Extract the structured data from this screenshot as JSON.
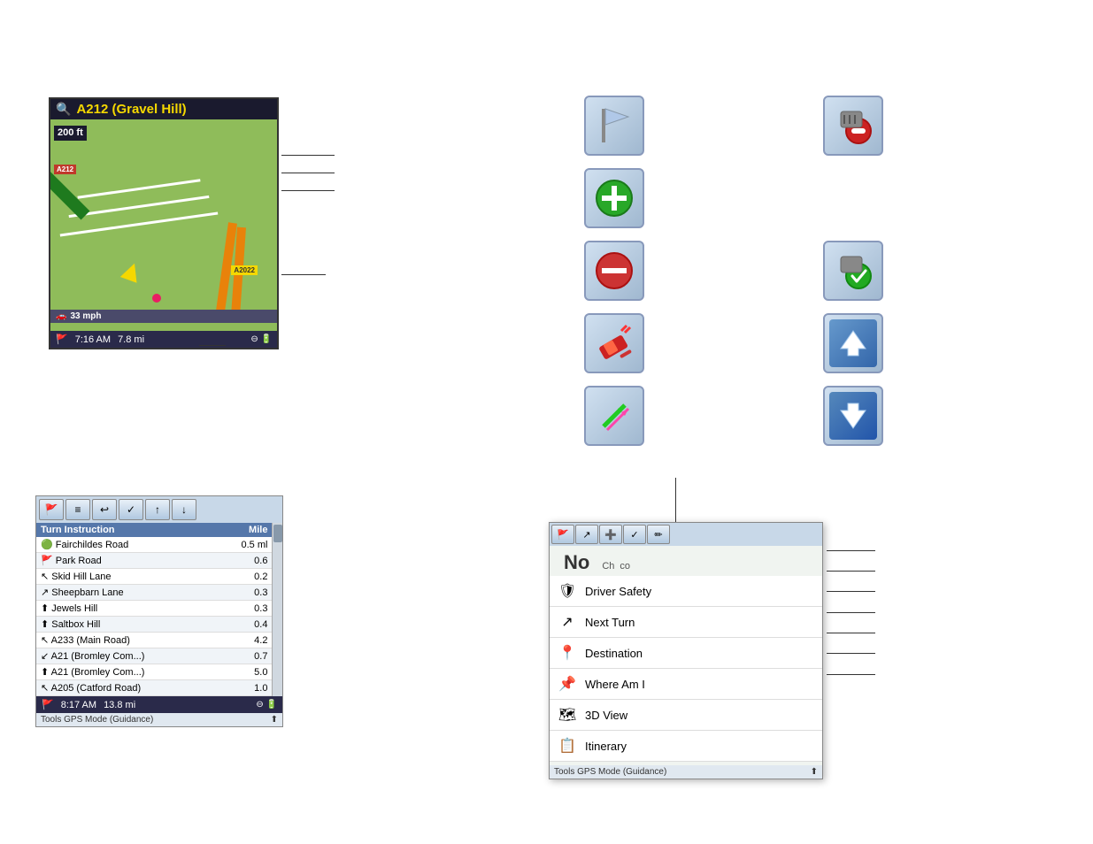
{
  "map": {
    "title": "A212 (Gravel Hill)",
    "distance_badge": "200\nft",
    "speed": "33 mph",
    "road_label": "A212",
    "road_label2": "A2022",
    "footer_time": "7:16 AM",
    "footer_dist": "7.8 mi"
  },
  "itinerary": {
    "toolbar_buttons": [
      "🚩",
      "≡",
      "↩",
      "✓",
      "↑",
      "↓"
    ],
    "columns": [
      "Turn Instruction",
      "Mile"
    ],
    "rows": [
      {
        "icon": "🟢",
        "name": "Fairchildes Road",
        "mile": "0.5 ml"
      },
      {
        "icon": "🚩",
        "name": "Park Road",
        "mile": "0.6"
      },
      {
        "icon": "↖",
        "name": "Skid Hill Lane",
        "mile": "0.2"
      },
      {
        "icon": "↗",
        "name": "Sheepbarn Lane",
        "mile": "0.3"
      },
      {
        "icon": "⬆",
        "name": "Jewels Hill",
        "mile": "0.3"
      },
      {
        "icon": "⬆",
        "name": "Saltbox Hill",
        "mile": "0.4"
      },
      {
        "icon": "↖",
        "name": "A233 (Main Road)",
        "mile": "4.2"
      },
      {
        "icon": "↙",
        "name": "A21 (Bromley Com...",
        "mile": "0.7"
      },
      {
        "icon": "⬆",
        "name": "A21 (Bromley Com...",
        "mile": "5.0"
      },
      {
        "icon": "↖",
        "name": "A205 (Catford Road)",
        "mile": "1.0"
      }
    ],
    "footer_time": "8:17 AM",
    "footer_dist": "13.8 mi",
    "footer_label": "Tools GPS Mode (Guidance)"
  },
  "icon_buttons": {
    "flag": {
      "label": "Flag",
      "symbol": "🏳"
    },
    "plus": {
      "label": "Add Waypoint",
      "symbol": "➕"
    },
    "minus": {
      "label": "Remove Waypoint",
      "symbol": "➖"
    },
    "eraser_red": {
      "label": "Delete Route",
      "symbol": "🗑"
    },
    "arrow_green": {
      "label": "Route Arrow Green",
      "symbol": "↗"
    },
    "check_green": {
      "label": "Accept",
      "symbol": "✅"
    },
    "arrow_up": {
      "label": "Move Up",
      "symbol": "⬆"
    },
    "arrow_down": {
      "label": "Move Down",
      "symbol": "⬇"
    }
  },
  "dropdown": {
    "toolbar_buttons": [
      "🚩",
      "↗",
      "➕",
      "✓",
      "✏"
    ],
    "header_text": "No",
    "subtext": "Ch    co",
    "menu_items": [
      {
        "icon": "🛡",
        "label": "Driver Safety"
      },
      {
        "icon": "↗",
        "label": "Next Turn"
      },
      {
        "icon": "📍",
        "label": "Destination"
      },
      {
        "icon": "📌",
        "label": "Where Am I"
      },
      {
        "icon": "🗺",
        "label": "3D View"
      },
      {
        "icon": "📋",
        "label": "Itinerary"
      }
    ],
    "footer_label": "Tools GPS Mode (Guidance)"
  },
  "callout_labels": {
    "map_c1": "",
    "map_c2": "",
    "map_c3": "",
    "map_c4": "",
    "map_c5": ""
  }
}
